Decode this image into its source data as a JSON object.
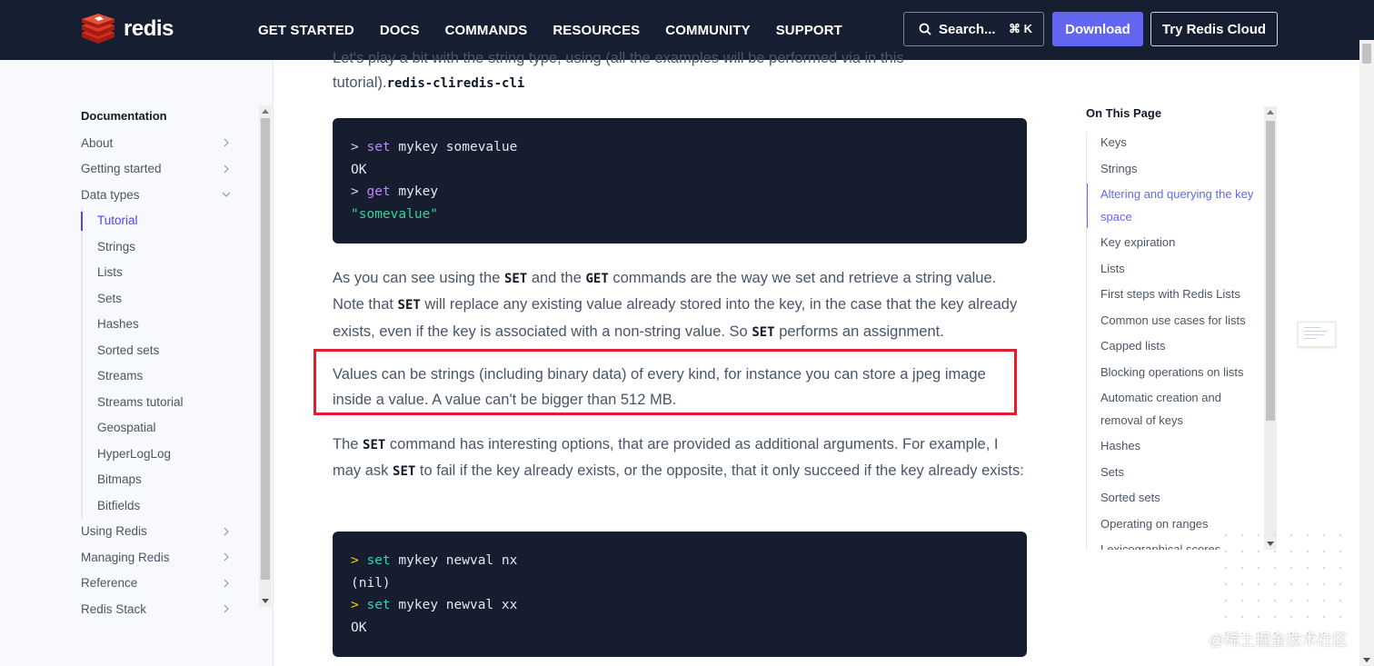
{
  "brand": {
    "name": "redis",
    "logo_color": "#dc382c"
  },
  "nav": {
    "links": [
      "GET STARTED",
      "DOCS",
      "COMMANDS",
      "RESOURCES",
      "COMMUNITY",
      "SUPPORT"
    ],
    "search_label": "Search...",
    "search_shortcut": "⌘ K",
    "download_label": "Download",
    "cloud_label": "Try Redis Cloud"
  },
  "sidebar": {
    "title": "Documentation",
    "top_items": [
      "About",
      "Getting started",
      "Data types"
    ],
    "sub_items": [
      "Tutorial",
      "Strings",
      "Lists",
      "Sets",
      "Hashes",
      "Sorted sets",
      "Streams",
      "Streams tutorial",
      "Geospatial",
      "HyperLogLog",
      "Bitmaps",
      "Bitfields"
    ],
    "bottom_items": [
      "Using Redis",
      "Managing Redis",
      "Reference",
      "Redis Stack"
    ]
  },
  "content": {
    "intro_partial": "Let's play a bit with the string type, using (all the examples will be performed via in this",
    "intro_line2": "tutorial).",
    "intro_code": "redis-cliredis-cli",
    "code1": {
      "l1_prompt": ">",
      "l1_cmd": "set",
      "l1_args": "mykey somevalue",
      "l2": "OK",
      "l3_prompt": ">",
      "l3_cmd": "get",
      "l3_args": "mykey",
      "l4": "\"somevalue\""
    },
    "p1": {
      "a": "As you can see using the ",
      "c1": "SET",
      "b": " and the ",
      "c2": "GET",
      "d": " commands are the way we set and retrieve a string value. Note that ",
      "c3": "SET",
      "e": " will replace any existing value already stored into the key, in the case that the key already exists, even if the key is associated with a non-string value. So ",
      "c4": "SET",
      "f": " performs an assignment."
    },
    "p2": "Values can be strings (including binary data) of every kind, for instance you can store a jpeg image inside a value. A value can't be bigger than 512 MB.",
    "p3": {
      "a": "The ",
      "c1": "SET",
      "b": " command has interesting options, that are provided as additional arguments. For example, I may ask ",
      "c2": "SET",
      "c": " to fail if the key already exists, or the opposite, that it only succeed if the key already exists:"
    },
    "code2": {
      "l1_prompt": ">",
      "l1_cmd": "set",
      "l1_args": "mykey newval nx",
      "l2": "(nil)",
      "l3_prompt": ">",
      "l3_cmd": "set",
      "l3_args": "mykey newval xx",
      "l4": "OK"
    }
  },
  "toc": {
    "title": "On This Page",
    "items": [
      "Keys",
      "Strings",
      "Altering and querying the key space",
      "Key expiration",
      "Lists",
      "First steps with Redis Lists",
      "Common use cases for lists",
      "Capped lists",
      "Blocking operations on lists",
      "Automatic creation and removal of keys",
      "Hashes",
      "Sets",
      "Sorted sets",
      "Operating on ranges",
      "Lexicographical scores"
    ],
    "active_index": 2
  },
  "watermark": "@稀土掘金技术社区"
}
